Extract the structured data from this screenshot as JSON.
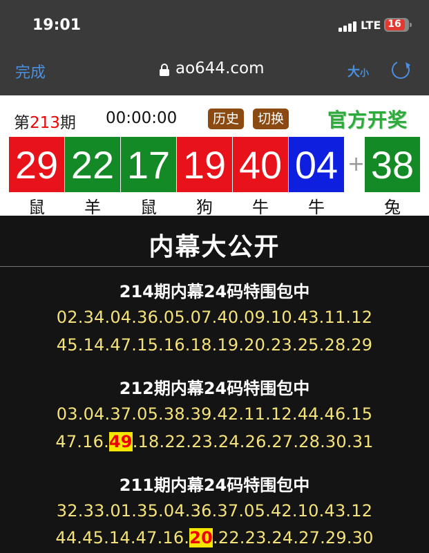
{
  "status_bar": {
    "time": "19:01",
    "network": "LTE",
    "battery": "16"
  },
  "toolbar": {
    "done_label": "完成",
    "url": "ao644.com",
    "text_size_big": "大",
    "text_size_small": "小"
  },
  "draw": {
    "issue_prefix": "第",
    "issue_number": "213",
    "issue_suffix": "期",
    "countdown": "00:00:00",
    "history_label": "历史",
    "switch_label": "切换",
    "official_label": "官方开奖",
    "plus": "+",
    "balls": [
      {
        "number": "29",
        "zodiac": "鼠",
        "color": "#e8121b"
      },
      {
        "number": "22",
        "zodiac": "羊",
        "color": "#138a26"
      },
      {
        "number": "17",
        "zodiac": "鼠",
        "color": "#138a26"
      },
      {
        "number": "19",
        "zodiac": "狗",
        "color": "#e8121b"
      },
      {
        "number": "40",
        "zodiac": "牛",
        "color": "#e8121b"
      },
      {
        "number": "04",
        "zodiac": "牛",
        "color": "#0f1fe0"
      }
    ],
    "special": {
      "number": "38",
      "zodiac": "兔",
      "color": "#138a26"
    }
  },
  "reveal": {
    "title": "内幕大公开",
    "blocks": [
      {
        "title": "214期内幕24码特围包中",
        "line1": "02.34.04.36.05.07.40.09.10.43.11.12",
        "line2_a": "45.14.47.15.16.18.19.20.23.25.28.29",
        "line2_hit": "",
        "line2_b": ""
      },
      {
        "title": "212期内幕24码特围包中",
        "line1": "03.04.37.05.38.39.42.11.12.44.46.15",
        "line2_a": "47.16.",
        "line2_hit": "49",
        "line2_b": ".18.22.23.24.26.27.28.30.31"
      },
      {
        "title": "211期内幕24码特围包中",
        "line1": "32.33.01.35.04.36.37.05.42.10.43.12",
        "line2_a": "44.45.14.47.16.",
        "line2_hit": "20",
        "line2_b": ".22.23.24.27.29.30"
      }
    ]
  }
}
